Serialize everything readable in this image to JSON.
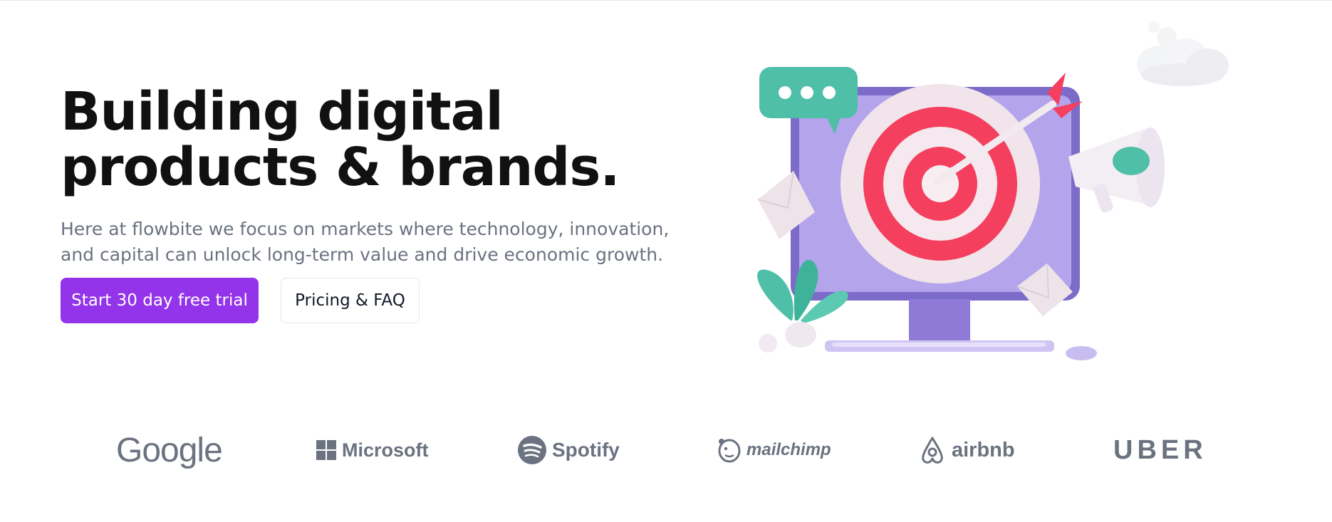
{
  "hero": {
    "title_line1": "Building digital",
    "title_line2": "products & brands.",
    "subtitle_line1": "Here at flowbite we focus on markets where technology, innovation,",
    "subtitle_line2": "and capital can unlock long-term value and drive economic growth.",
    "primary_button": "Start 30 day free trial",
    "secondary_button": "Pricing & FAQ"
  },
  "illustration": {
    "icon": "target-on-monitor-illustration",
    "colors": {
      "monitor": "#a78bdc",
      "target_red": "#f43f5e",
      "chat_bubble": "#4fbfa8"
    }
  },
  "logos": [
    {
      "name": "Google",
      "icon": "google-logo"
    },
    {
      "name": "Microsoft",
      "icon": "microsoft-logo"
    },
    {
      "name": "Spotify",
      "icon": "spotify-logo"
    },
    {
      "name": "mailchimp",
      "icon": "mailchimp-logo"
    },
    {
      "name": "airbnb",
      "icon": "airbnb-logo"
    },
    {
      "name": "UBER",
      "icon": "uber-logo"
    }
  ],
  "colors": {
    "accent": "#9333ea",
    "text_dark": "#111111",
    "text_muted": "#6b7280",
    "logo_gray": "#6b7280"
  }
}
